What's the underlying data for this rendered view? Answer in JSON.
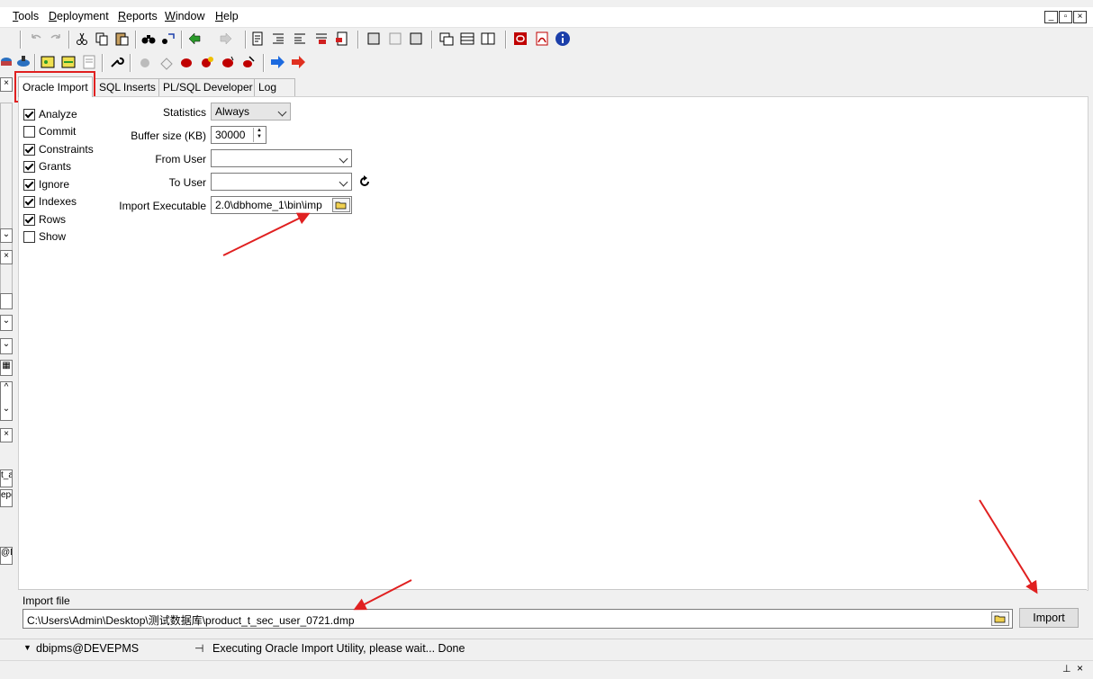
{
  "menu": {
    "items": [
      "Tools",
      "Deployment",
      "Reports",
      "Window",
      "Help"
    ],
    "mnemonics": [
      "T",
      "D",
      "R",
      "W",
      "H"
    ]
  },
  "tabs": [
    {
      "label": "Oracle Import",
      "active": true
    },
    {
      "label": "SQL Inserts",
      "active": false
    },
    {
      "label": "PL/SQL Developer",
      "active": false
    },
    {
      "label": "Log",
      "active": false
    }
  ],
  "options": [
    {
      "label": "Analyze",
      "checked": true
    },
    {
      "label": "Commit",
      "checked": false
    },
    {
      "label": "Constraints",
      "checked": true
    },
    {
      "label": "Grants",
      "checked": true
    },
    {
      "label": "Ignore",
      "checked": true
    },
    {
      "label": "Indexes",
      "checked": true
    },
    {
      "label": "Rows",
      "checked": true
    },
    {
      "label": "Show",
      "checked": false
    }
  ],
  "fields": {
    "statistics": {
      "label": "Statistics",
      "value": "Always"
    },
    "buffer_size": {
      "label": "Buffer size (KB)",
      "value": "30000"
    },
    "from_user": {
      "label": "From User",
      "value": ""
    },
    "to_user": {
      "label": "To User",
      "value": ""
    },
    "import_executable": {
      "label": "Import Executable",
      "value": "2.0\\dbhome_1\\bin\\imp"
    }
  },
  "import_file": {
    "label": "Import file",
    "value": "C:\\Users\\Admin\\Desktop\\测试数据库\\product_t_sec_user_0721.dmp"
  },
  "import_button": "Import",
  "left_strip_labels": [
    "t_a",
    "epo",
    "@D"
  ],
  "status": {
    "connection": "dbipms@DEVEPMS",
    "message": "Executing Oracle Import Utility, please wait... Done"
  },
  "colors": {
    "annotation": "#e02020",
    "oracle_red": "#c00000",
    "info_blue": "#1c3faa"
  },
  "icons": [
    "undo-icon",
    "redo-icon",
    "cut-icon",
    "copy-icon",
    "paste-icon",
    "find-icon",
    "replace-icon",
    "info-icon",
    "refresh-icon",
    "folder-open-icon"
  ]
}
